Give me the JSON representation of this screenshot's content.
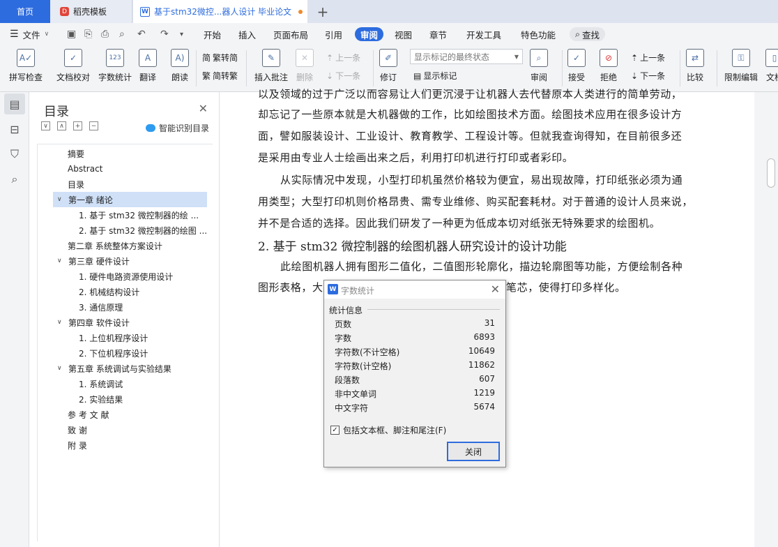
{
  "tabs": {
    "home": "首页",
    "template": "稻壳模板",
    "doc": "基于stm32微控...器人设计 毕业论文"
  },
  "menu": {
    "file": "文件",
    "items": [
      "开始",
      "插入",
      "页面布局",
      "引用",
      "审阅",
      "视图",
      "章节",
      "开发工具",
      "特色功能"
    ],
    "active": "审阅",
    "search": "查找"
  },
  "ribbon": {
    "spell": "拼写检查",
    "proof": "文档校对",
    "wordcount": "字数统计",
    "translate": "翻译",
    "read": "朗读",
    "t2s": "繁转简",
    "s2t": "简转繁",
    "insert_comment": "插入批注",
    "delete": "删除",
    "prev_item": "上一条",
    "next_item": "下一条",
    "revise": "修订",
    "markup_select": "显示标记的最终状态",
    "show_markup": "显示标记",
    "review": "审阅",
    "accept": "接受",
    "reject": "拒绝",
    "prev": "上一条",
    "next": "下一条",
    "compare": "比较",
    "restrict": "限制编辑",
    "doc_more": "文档"
  },
  "toc": {
    "title": "目录",
    "smart": "智能识别目录",
    "items": [
      "摘要",
      "Abstract",
      "目录",
      "第一章 绪论",
      "1. 基于 stm32 微控制器的绘 ...",
      "2. 基于 stm32 微控制器的绘图 ...",
      "第二章 系统整体方案设计",
      "第三章 硬件设计",
      "1. 硬件电路资源使用设计",
      "2. 机械结构设计",
      "3. 通信原理",
      "第四章 软件设计",
      "1. 上位机程序设计",
      "2. 下位机程序设计",
      "第五章 系统调试与实验结果",
      "1. 系统调试",
      "2. 实验结果",
      "参 考 文 献",
      "致 谢",
      "附 录"
    ]
  },
  "document": {
    "lines": [
      "以及领域的过于广泛以而容易让人们更沉浸于让机器人去代替原本人类进行的简单劳动，",
      "却忘记了一些原本就是大机器做的工作，比如绘图技术方面。绘图技术应用在很多设计方",
      "面，譬如服装设计、工业设计、教育教学、工程设计等。但就我查询得知，在目前很多还",
      "是采用由专业人士绘画出来之后，利用打印机进行打印或者彩印。",
      "从实际情况中发现，小型打印机虽然价格较为便宜，易出现故障，打印纸张必须为通",
      "用类型；大型打印机则价格昂贵、需专业维修、购买配套耗材。对于普通的设计人员来说，",
      "并不是合适的选择。因此我们研发了一种更为低成本切对纸张无特殊要求的绘图机。"
    ],
    "heading": "2. 基于  stm32 微控制器的绘图机器人研究设计的设计功能",
    "para3_line1": "此绘图机器人拥有图形二值化，二值图形轮廓化，描边轮廓图等功能，方便绘制各种",
    "para3_line2_left": "图形表格，大",
    "para3_line2_right": "笔芯，使得打印多样化。"
  },
  "dialog": {
    "title": "字数统计",
    "group": "统计信息",
    "stats": [
      {
        "label": "页数",
        "value": "31"
      },
      {
        "label": "字数",
        "value": "6893"
      },
      {
        "label": "字符数(不计空格)",
        "value": "10649"
      },
      {
        "label": "字符数(计空格)",
        "value": "11862"
      },
      {
        "label": "段落数",
        "value": "607"
      },
      {
        "label": "非中文单词",
        "value": "1219"
      },
      {
        "label": "中文字符",
        "value": "5674"
      }
    ],
    "checkbox": "包括文本框、脚注和尾注(F)",
    "checked": true,
    "close": "关闭"
  },
  "colors": {
    "accent": "#2d6cdf",
    "tab_dot": "#f08a2b",
    "selected": "#cfe0f7"
  }
}
